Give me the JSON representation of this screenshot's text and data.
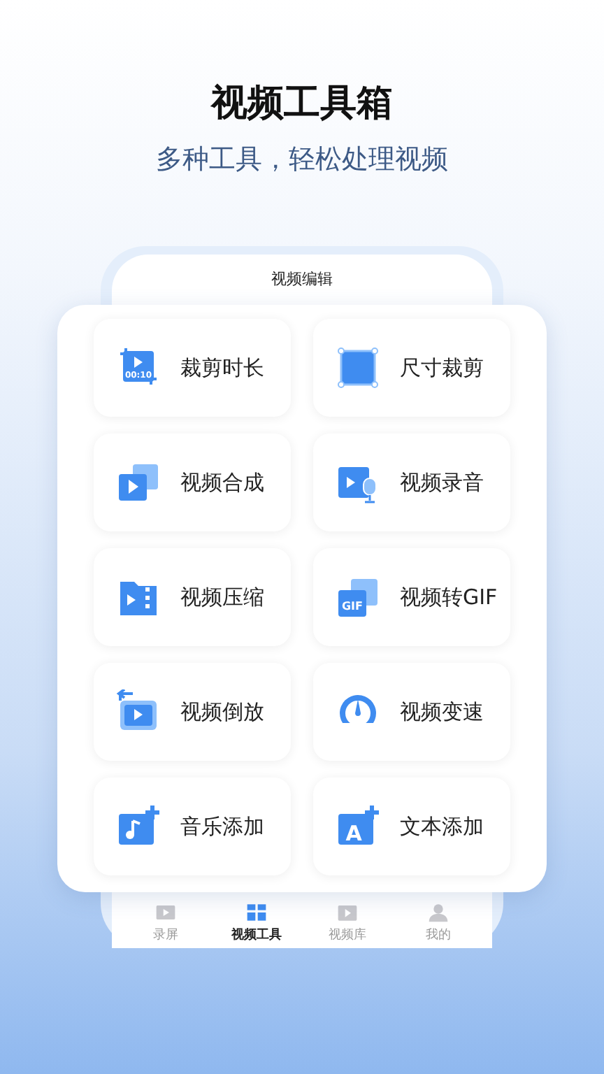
{
  "headline": "视频工具箱",
  "subtitle": "多种工具，轻松处理视频",
  "phone": {
    "header": "视频编辑",
    "tools": [
      {
        "kind": "trim",
        "label": "裁剪时长",
        "icon_text": "00:10"
      },
      {
        "kind": "crop",
        "label": "尺寸裁剪"
      },
      {
        "kind": "merge",
        "label": "视频合成"
      },
      {
        "kind": "voice",
        "label": "视频录音"
      },
      {
        "kind": "compress",
        "label": "视频压缩"
      },
      {
        "kind": "gif",
        "label": "视频转GIF",
        "icon_text": "GIF"
      },
      {
        "kind": "reverse",
        "label": "视频倒放"
      },
      {
        "kind": "speed",
        "label": "视频变速"
      },
      {
        "kind": "music",
        "label": "音乐添加"
      },
      {
        "kind": "text",
        "label": "文本添加",
        "icon_text": "A"
      }
    ],
    "tabs": [
      {
        "kind": "record",
        "label": "录屏",
        "selected": false
      },
      {
        "kind": "tools",
        "label": "视频工具",
        "selected": true
      },
      {
        "kind": "library",
        "label": "视频库",
        "selected": false
      },
      {
        "kind": "mine",
        "label": "我的",
        "selected": false
      }
    ]
  }
}
